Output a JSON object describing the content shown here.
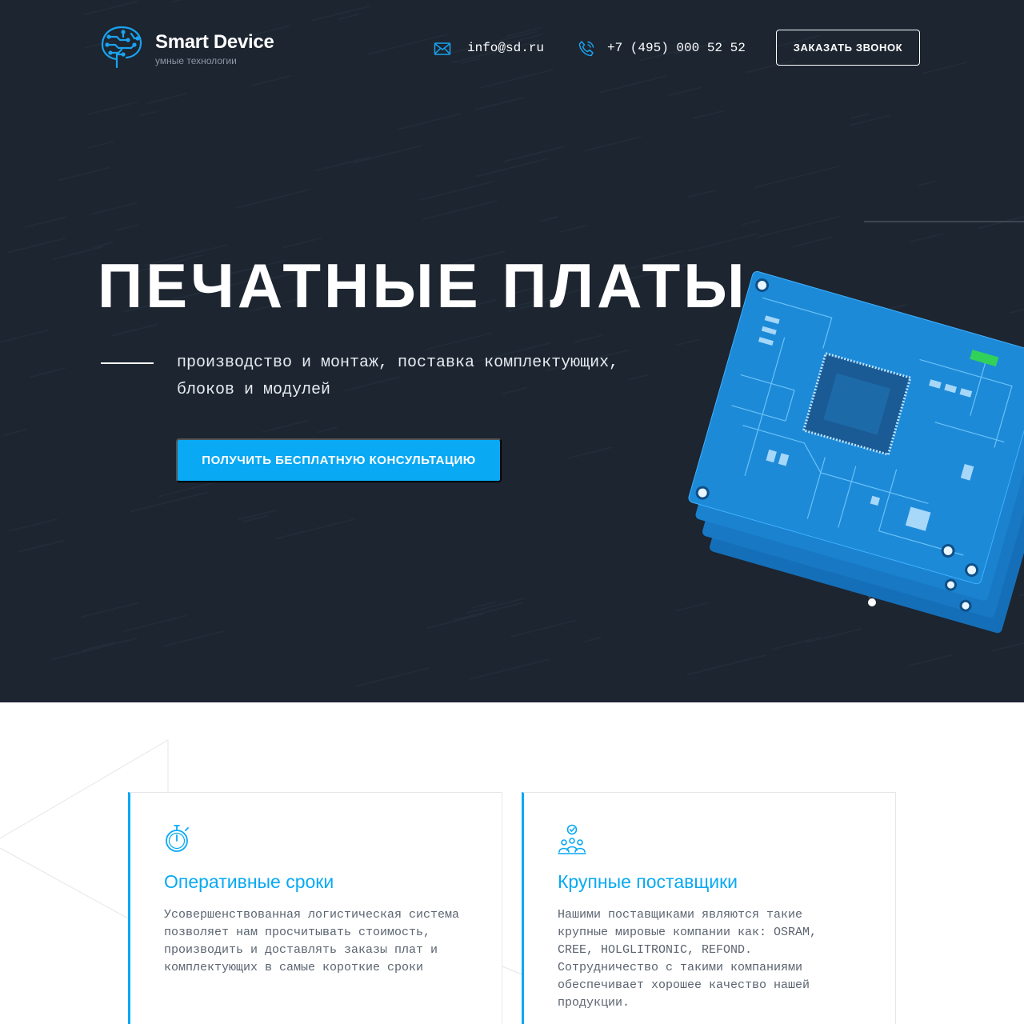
{
  "brand": {
    "name": "Smart Device",
    "tagline": "умные технологии"
  },
  "header": {
    "email": "info@sd.ru",
    "phone": "+7 (495) 000 52 52",
    "callback_label": "ЗАКАЗАТЬ ЗВОНОК"
  },
  "hero": {
    "title": "ПЕЧАТНЫЕ ПЛАТЫ",
    "subtitle": "производство и монтаж, поставка комплектующих, блоков и модулей",
    "cta_label": "ПОЛУЧИТЬ БЕСПЛАТНУЮ КОНСУЛЬТАЦИЮ"
  },
  "features": [
    {
      "icon": "stopwatch-icon",
      "title": "Оперативные сроки",
      "text": "Усовершенствованная логистическая система позволяет нам просчитывать стоимость, производить и доставлять заказы плат и комплектующих в самые короткие сроки"
    },
    {
      "icon": "suppliers-icon",
      "title": "Крупные поставщики",
      "text": "Нашими поставщиками являются такие крупные мировые компании как: OSRAM, CREE, HOLGLITRONIC, REFOND. Сотрудничество с такими компаниями обеспечивает хорошее качество нашей продукции."
    }
  ],
  "colors": {
    "accent": "#09a9f3",
    "hero_bg": "#1c2530",
    "pcb": "#1e7fd0"
  }
}
